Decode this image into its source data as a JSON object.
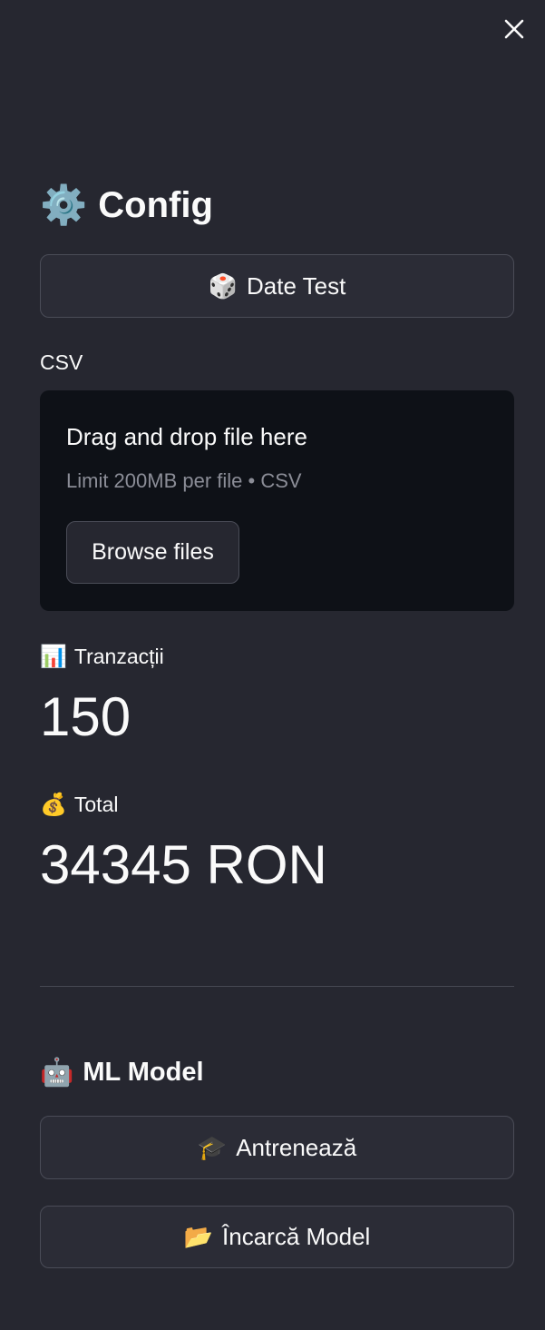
{
  "sidebar": {
    "close_icon": "close-icon",
    "config_heading": {
      "emoji": "⚙️",
      "text": "Config"
    },
    "date_test_button": {
      "emoji": "🎲",
      "label": "Date Test"
    },
    "csv_uploader": {
      "label": "CSV",
      "dropzone_title": "Drag and drop file here",
      "dropzone_subtitle": "Limit 200MB per file • CSV",
      "browse_label": "Browse files"
    },
    "metrics": {
      "transactions": {
        "emoji": "📊",
        "label": "Tranzacții",
        "value": "150"
      },
      "total": {
        "emoji": "💰",
        "label": "Total",
        "value": "34345 RON"
      }
    },
    "ml_heading": {
      "emoji": "🤖",
      "text": "ML Model"
    },
    "train_button": {
      "emoji": "🎓",
      "label": "Antrenează"
    },
    "load_model_button": {
      "emoji": "📂",
      "label": "Încarcă Model"
    }
  },
  "colors": {
    "background": "#262730",
    "dropzone_background": "#0e1117",
    "text": "#fafafa",
    "muted_text": "#8b8d97",
    "border": "#4a4c57"
  }
}
